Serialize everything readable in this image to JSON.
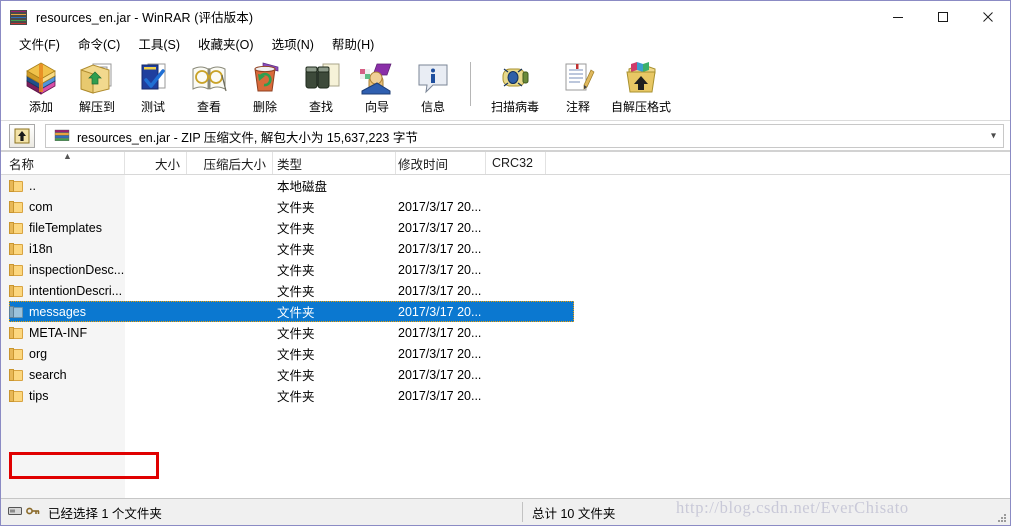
{
  "window": {
    "title": "resources_en.jar - WinRAR (评估版本)",
    "icon": "winrar-books-icon",
    "controls": {
      "minimize": "minimize-icon",
      "maximize": "maximize-icon",
      "close": "close-icon"
    },
    "border_color": "#8b8bc4"
  },
  "menubar": {
    "items": [
      {
        "label": "文件(F)"
      },
      {
        "label": "命令(C)"
      },
      {
        "label": "工具(S)"
      },
      {
        "label": "收藏夹(O)"
      },
      {
        "label": "选项(N)"
      },
      {
        "label": "帮助(H)"
      }
    ]
  },
  "toolbar": {
    "buttons": [
      {
        "label": "添加",
        "icon": "archive-add-icon"
      },
      {
        "label": "解压到",
        "icon": "extract-to-folder-icon"
      },
      {
        "label": "测试",
        "icon": "test-check-icon"
      },
      {
        "label": "查看",
        "icon": "view-glasses-icon"
      },
      {
        "label": "删除",
        "icon": "delete-trash-icon"
      },
      {
        "label": "查找",
        "icon": "find-binoculars-icon"
      },
      {
        "label": "向导",
        "icon": "wizard-icon"
      },
      {
        "label": "信息",
        "icon": "info-icon"
      }
    ],
    "buttons2": [
      {
        "label": "扫描病毒",
        "icon": "virus-scan-icon"
      },
      {
        "label": "注释",
        "icon": "comment-pencil-icon"
      },
      {
        "label": "自解压格式",
        "icon": "sfx-box-icon"
      }
    ]
  },
  "addressbar": {
    "up_button": "up-one-level-icon",
    "archive_icon": "winrar-books-icon",
    "path_text": "resources_en.jar - ZIP 压缩文件, 解包大小为 15,637,223 字节",
    "chevron": "chevron-down-icon"
  },
  "filelist": {
    "columns": [
      {
        "key": "name",
        "label": "名称",
        "align": "left",
        "sorted": "asc"
      },
      {
        "key": "size",
        "label": "大小",
        "align": "right"
      },
      {
        "key": "packed",
        "label": "压缩后大小",
        "align": "right"
      },
      {
        "key": "type",
        "label": "类型",
        "align": "left"
      },
      {
        "key": "date",
        "label": "修改时间",
        "align": "left"
      },
      {
        "key": "crc",
        "label": "CRC32",
        "align": "left"
      }
    ],
    "rows": [
      {
        "name": "..",
        "size": "",
        "packed": "",
        "type": "本地磁盘",
        "date": "",
        "crc": "",
        "selected": false
      },
      {
        "name": "com",
        "size": "",
        "packed": "",
        "type": "文件夹",
        "date": "2017/3/17 20...",
        "crc": "",
        "selected": false
      },
      {
        "name": "fileTemplates",
        "size": "",
        "packed": "",
        "type": "文件夹",
        "date": "2017/3/17 20...",
        "crc": "",
        "selected": false
      },
      {
        "name": "i18n",
        "size": "",
        "packed": "",
        "type": "文件夹",
        "date": "2017/3/17 20...",
        "crc": "",
        "selected": false
      },
      {
        "name": "inspectionDesc...",
        "size": "",
        "packed": "",
        "type": "文件夹",
        "date": "2017/3/17 20...",
        "crc": "",
        "selected": false
      },
      {
        "name": "intentionDescri...",
        "size": "",
        "packed": "",
        "type": "文件夹",
        "date": "2017/3/17 20...",
        "crc": "",
        "selected": false
      },
      {
        "name": "messages",
        "size": "",
        "packed": "",
        "type": "文件夹",
        "date": "2017/3/17 20...",
        "crc": "",
        "selected": true
      },
      {
        "name": "META-INF",
        "size": "",
        "packed": "",
        "type": "文件夹",
        "date": "2017/3/17 20...",
        "crc": "",
        "selected": false
      },
      {
        "name": "org",
        "size": "",
        "packed": "",
        "type": "文件夹",
        "date": "2017/3/17 20...",
        "crc": "",
        "selected": false
      },
      {
        "name": "search",
        "size": "",
        "packed": "",
        "type": "文件夹",
        "date": "2017/3/17 20...",
        "crc": "",
        "selected": false
      },
      {
        "name": "tips",
        "size": "",
        "packed": "",
        "type": "文件夹",
        "date": "2017/3/17 20...",
        "crc": "",
        "selected": false
      }
    ],
    "selection_color": "#0b78d0",
    "annotation": {
      "shape": "rectangle",
      "color": "#e00000",
      "target": "messages"
    }
  },
  "statusbar": {
    "disk_icon": "disk-icon",
    "key_icon": "key-icon",
    "left_text": "已经选择 1 个文件夹",
    "right_text": "总计 10 文件夹",
    "grip": "resize-grip-icon"
  },
  "watermark": {
    "text": "http://blog.csdn.net/EverChisato"
  }
}
